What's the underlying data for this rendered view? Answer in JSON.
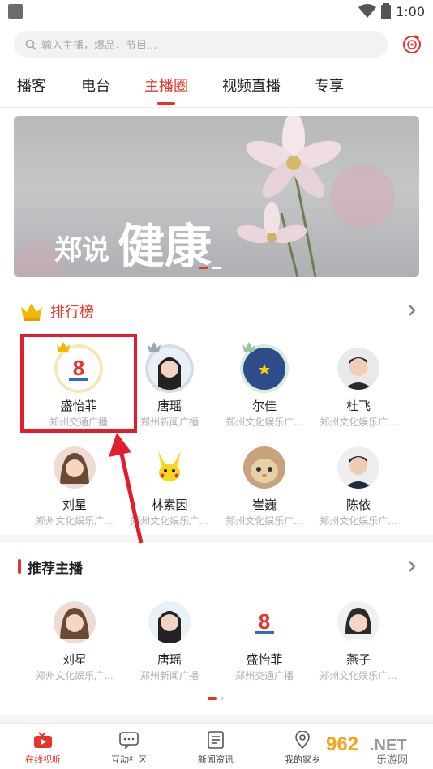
{
  "status_bar": {
    "time": "1:00"
  },
  "search": {
    "placeholder": "输入主播，爆品，节目..."
  },
  "tabs": [
    {
      "label": "播客"
    },
    {
      "label": "电台"
    },
    {
      "label": "主播圈",
      "active": true
    },
    {
      "label": "视频直播"
    },
    {
      "label": "专享"
    }
  ],
  "banner": {
    "text_small": "郑说",
    "text_big": "健康"
  },
  "ranking": {
    "title": "排行榜",
    "anchors": [
      {
        "name": "盛怡菲",
        "station": "郑州交通广播",
        "avatar": "station-logo-8"
      },
      {
        "name": "唐瑶",
        "station": "郑州新闻广播",
        "avatar": "girl-photo"
      },
      {
        "name": "尔佳",
        "station": "郑州文化娱乐广...",
        "avatar": "blue-star-circle"
      },
      {
        "name": "杜飞",
        "station": "郑州文化娱乐广...",
        "avatar": "man-photo"
      },
      {
        "name": "刘星",
        "station": "郑州文化娱乐广...",
        "avatar": "woman-photo"
      },
      {
        "name": "林素因",
        "station": "郑州文化娱乐广...",
        "avatar": "pikachu"
      },
      {
        "name": "崔巍",
        "station": "郑州文化娱乐广...",
        "avatar": "cat-photo"
      },
      {
        "name": "陈依",
        "station": "郑州文化娱乐广...",
        "avatar": "man-photo-2"
      }
    ]
  },
  "recommend": {
    "title": "推荐主播",
    "anchors": [
      {
        "name": "刘星",
        "station": "郑州文化娱乐广..."
      },
      {
        "name": "唐瑶",
        "station": "郑州新闻广播"
      },
      {
        "name": "盛怡菲",
        "station": "郑州交通广播"
      },
      {
        "name": "燕子",
        "station": "郑州文化娱乐广..."
      }
    ]
  },
  "bottom_nav": [
    {
      "label": "在线视听",
      "icon": "tv-icon",
      "active": true
    },
    {
      "label": "互动社区",
      "icon": "chat-icon"
    },
    {
      "label": "新闻资讯",
      "icon": "news-icon"
    },
    {
      "label": "我的家乡",
      "icon": "location-icon"
    }
  ],
  "watermark": {
    "text": "962.NET",
    "sub": "乐游网"
  },
  "colors": {
    "accent": "#e5352b",
    "highlight": "#e11d2e"
  }
}
